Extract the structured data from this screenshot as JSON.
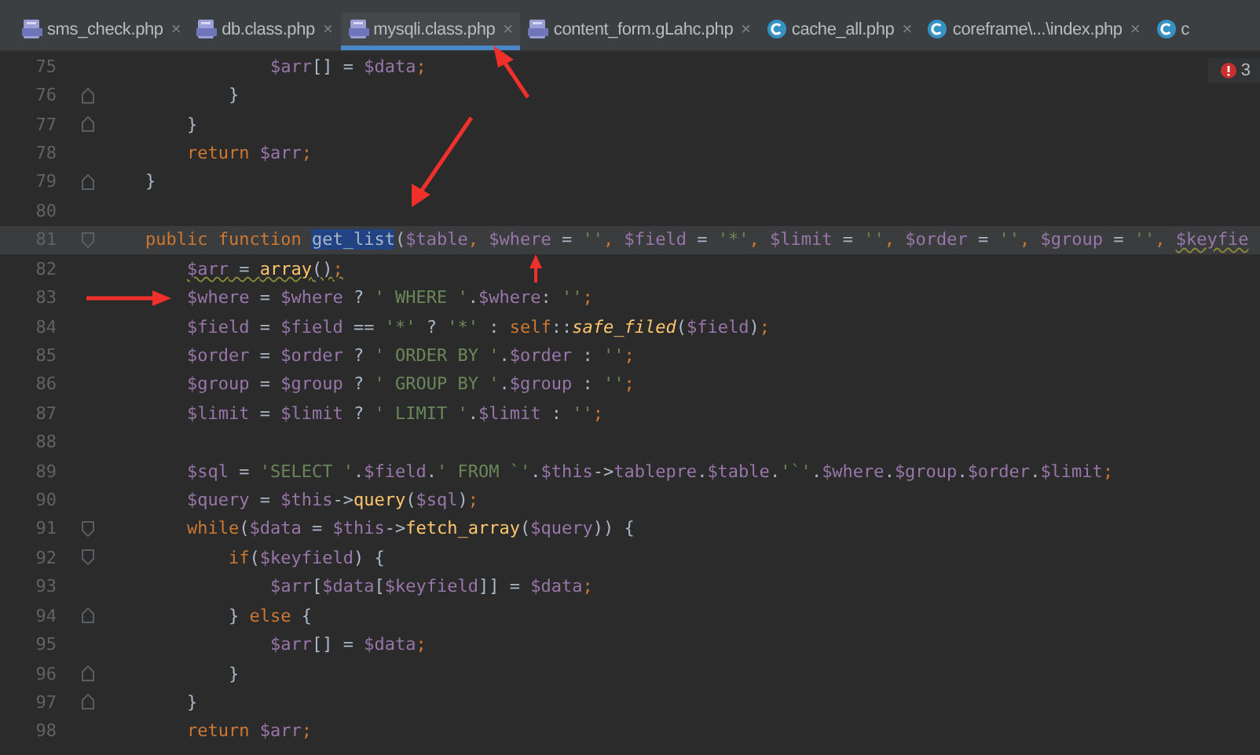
{
  "tabs": [
    {
      "label": "sms_check.php",
      "kind": "php",
      "close": "×",
      "selected": false
    },
    {
      "label": "db.class.php",
      "kind": "php",
      "close": "×",
      "selected": false
    },
    {
      "label": "mysqli.class.php",
      "kind": "php",
      "close": "×",
      "selected": true
    },
    {
      "label": "content_form.gLahc.php",
      "kind": "php",
      "close": "×",
      "selected": false
    },
    {
      "label": "cache_all.php",
      "kind": "class",
      "close": "×",
      "selected": false
    },
    {
      "label": "coreframe\\...\\index.php",
      "kind": "class",
      "close": "×",
      "selected": false
    },
    {
      "label": "c",
      "kind": "class",
      "selected": false
    }
  ],
  "problems": {
    "count": "3"
  },
  "lines": [
    {
      "number": "75",
      "kind": "plain",
      "current": false,
      "tokens": [
        {
          "kind": "var",
          "text": "                $arr"
        },
        {
          "kind": "plain",
          "text": "[] = "
        },
        {
          "kind": "var",
          "text": "$data"
        },
        {
          "kind": "punc",
          "text": ";"
        }
      ]
    },
    {
      "number": "76",
      "kind": "fold_end",
      "current": false,
      "tokens": [
        {
          "kind": "plain",
          "text": "            }"
        }
      ]
    },
    {
      "number": "77",
      "kind": "fold_end",
      "current": false,
      "tokens": [
        {
          "kind": "plain",
          "text": "        }"
        }
      ]
    },
    {
      "number": "78",
      "kind": "plain",
      "current": false,
      "tokens": [
        {
          "kind": "kw",
          "text": "        return "
        },
        {
          "kind": "var",
          "text": "$arr"
        },
        {
          "kind": "punc",
          "text": ";"
        }
      ]
    },
    {
      "number": "79",
      "kind": "fold_end",
      "current": false,
      "tokens": [
        {
          "kind": "plain",
          "text": "    }"
        }
      ]
    },
    {
      "number": "80",
      "kind": "plain",
      "current": false
    },
    {
      "number": "81",
      "kind": "fold_start",
      "current": true,
      "tokens": [
        {
          "kind": "kw",
          "text": "    public function "
        },
        {
          "kind": "fn_selected",
          "text": "get_list"
        },
        {
          "kind": "plain",
          "text": "("
        },
        {
          "kind": "var",
          "text": "$table"
        },
        {
          "kind": "punc",
          "text": ", "
        },
        {
          "kind": "var",
          "text": "$where"
        },
        {
          "kind": "plain",
          "text": " = "
        },
        {
          "kind": "str",
          "text": "''"
        },
        {
          "kind": "punc",
          "text": ", "
        },
        {
          "kind": "var",
          "text": "$field"
        },
        {
          "kind": "plain",
          "text": " = "
        },
        {
          "kind": "str",
          "text": "'*'"
        },
        {
          "kind": "punc",
          "text": ", "
        },
        {
          "kind": "var",
          "text": "$limit"
        },
        {
          "kind": "plain",
          "text": " = "
        },
        {
          "kind": "str",
          "text": "''"
        },
        {
          "kind": "punc",
          "text": ", "
        },
        {
          "kind": "var",
          "text": "$order"
        },
        {
          "kind": "plain",
          "text": " = "
        },
        {
          "kind": "str",
          "text": "''"
        },
        {
          "kind": "punc",
          "text": ", "
        },
        {
          "kind": "var",
          "text": "$group"
        },
        {
          "kind": "plain",
          "text": " = "
        },
        {
          "kind": "str",
          "text": "''"
        },
        {
          "kind": "punc",
          "text": ", "
        },
        {
          "kind": "var_warn",
          "text": "$keyfie"
        }
      ]
    },
    {
      "number": "82",
      "kind": "plain",
      "current": false,
      "tokens": [
        {
          "kind": "var_warn",
          "text": "        $arr"
        },
        {
          "kind": "plain_warn",
          "text": " = "
        },
        {
          "kind": "fn_warn",
          "text": "array"
        },
        {
          "kind": "plain_warn",
          "text": "()"
        },
        {
          "kind": "punc_warn",
          "text": ";"
        }
      ]
    },
    {
      "number": "83",
      "kind": "plain",
      "current": false,
      "tokens": [
        {
          "kind": "var",
          "text": "        $where"
        },
        {
          "kind": "plain",
          "text": " = "
        },
        {
          "kind": "var",
          "text": "$where"
        },
        {
          "kind": "plain",
          "text": " ? "
        },
        {
          "kind": "str",
          "text": "' WHERE '"
        },
        {
          "kind": "plain",
          "text": "."
        },
        {
          "kind": "var",
          "text": "$where"
        },
        {
          "kind": "plain",
          "text": ": "
        },
        {
          "kind": "str",
          "text": "''"
        },
        {
          "kind": "punc",
          "text": ";"
        }
      ]
    },
    {
      "number": "84",
      "kind": "plain",
      "current": false,
      "tokens": [
        {
          "kind": "var",
          "text": "        $field"
        },
        {
          "kind": "plain",
          "text": " = "
        },
        {
          "kind": "var",
          "text": "$field"
        },
        {
          "kind": "plain",
          "text": " == "
        },
        {
          "kind": "str",
          "text": "'*'"
        },
        {
          "kind": "plain",
          "text": " ? "
        },
        {
          "kind": "str",
          "text": "'*'"
        },
        {
          "kind": "plain",
          "text": " : "
        },
        {
          "kind": "kw",
          "text": "self"
        },
        {
          "kind": "plain",
          "text": "::"
        },
        {
          "kind": "fn_static",
          "text": "safe_filed"
        },
        {
          "kind": "plain",
          "text": "("
        },
        {
          "kind": "var",
          "text": "$field"
        },
        {
          "kind": "plain",
          "text": ")"
        },
        {
          "kind": "punc",
          "text": ";"
        }
      ]
    },
    {
      "number": "85",
      "kind": "plain",
      "current": false,
      "tokens": [
        {
          "kind": "var",
          "text": "        $order"
        },
        {
          "kind": "plain",
          "text": " = "
        },
        {
          "kind": "var",
          "text": "$order"
        },
        {
          "kind": "plain",
          "text": " ? "
        },
        {
          "kind": "str",
          "text": "' ORDER BY '"
        },
        {
          "kind": "plain",
          "text": "."
        },
        {
          "kind": "var",
          "text": "$order"
        },
        {
          "kind": "plain",
          "text": " : "
        },
        {
          "kind": "str",
          "text": "''"
        },
        {
          "kind": "punc",
          "text": ";"
        }
      ]
    },
    {
      "number": "86",
      "kind": "plain",
      "current": false,
      "tokens": [
        {
          "kind": "var",
          "text": "        $group"
        },
        {
          "kind": "plain",
          "text": " = "
        },
        {
          "kind": "var",
          "text": "$group"
        },
        {
          "kind": "plain",
          "text": " ? "
        },
        {
          "kind": "str",
          "text": "' GROUP BY '"
        },
        {
          "kind": "plain",
          "text": "."
        },
        {
          "kind": "var",
          "text": "$group"
        },
        {
          "kind": "plain",
          "text": " : "
        },
        {
          "kind": "str",
          "text": "''"
        },
        {
          "kind": "punc",
          "text": ";"
        }
      ]
    },
    {
      "number": "87",
      "kind": "plain",
      "current": false,
      "tokens": [
        {
          "kind": "var",
          "text": "        $limit"
        },
        {
          "kind": "plain",
          "text": " = "
        },
        {
          "kind": "var",
          "text": "$limit"
        },
        {
          "kind": "plain",
          "text": " ? "
        },
        {
          "kind": "str",
          "text": "' LIMIT '"
        },
        {
          "kind": "plain",
          "text": "."
        },
        {
          "kind": "var",
          "text": "$limit"
        },
        {
          "kind": "plain",
          "text": " : "
        },
        {
          "kind": "str",
          "text": "''"
        },
        {
          "kind": "punc",
          "text": ";"
        }
      ]
    },
    {
      "number": "88",
      "kind": "plain",
      "current": false
    },
    {
      "number": "89",
      "kind": "plain",
      "current": false,
      "tokens": [
        {
          "kind": "var",
          "text": "        $sql"
        },
        {
          "kind": "plain",
          "text": " = "
        },
        {
          "kind": "str",
          "text": "'SELECT '"
        },
        {
          "kind": "plain",
          "text": "."
        },
        {
          "kind": "var",
          "text": "$field"
        },
        {
          "kind": "plain",
          "text": "."
        },
        {
          "kind": "str",
          "text": "' FROM `'"
        },
        {
          "kind": "plain",
          "text": "."
        },
        {
          "kind": "var",
          "text": "$this"
        },
        {
          "kind": "plain",
          "text": "->"
        },
        {
          "kind": "var",
          "text": "tablepre"
        },
        {
          "kind": "plain",
          "text": "."
        },
        {
          "kind": "var",
          "text": "$table"
        },
        {
          "kind": "plain",
          "text": "."
        },
        {
          "kind": "str",
          "text": "'`'"
        },
        {
          "kind": "plain",
          "text": "."
        },
        {
          "kind": "var",
          "text": "$where"
        },
        {
          "kind": "plain",
          "text": "."
        },
        {
          "kind": "var",
          "text": "$group"
        },
        {
          "kind": "plain",
          "text": "."
        },
        {
          "kind": "var",
          "text": "$order"
        },
        {
          "kind": "plain",
          "text": "."
        },
        {
          "kind": "var",
          "text": "$limit"
        },
        {
          "kind": "punc",
          "text": ";"
        }
      ]
    },
    {
      "number": "90",
      "kind": "plain",
      "current": false,
      "tokens": [
        {
          "kind": "var",
          "text": "        $query"
        },
        {
          "kind": "plain",
          "text": " = "
        },
        {
          "kind": "var",
          "text": "$this"
        },
        {
          "kind": "plain",
          "text": "->"
        },
        {
          "kind": "fn",
          "text": "query"
        },
        {
          "kind": "plain",
          "text": "("
        },
        {
          "kind": "var",
          "text": "$sql"
        },
        {
          "kind": "plain",
          "text": ")"
        },
        {
          "kind": "punc",
          "text": ";"
        }
      ]
    },
    {
      "number": "91",
      "kind": "fold_start",
      "current": false,
      "tokens": [
        {
          "kind": "kw",
          "text": "        while"
        },
        {
          "kind": "plain",
          "text": "("
        },
        {
          "kind": "var",
          "text": "$data"
        },
        {
          "kind": "plain",
          "text": " = "
        },
        {
          "kind": "var",
          "text": "$this"
        },
        {
          "kind": "plain",
          "text": "->"
        },
        {
          "kind": "fn",
          "text": "fetch_array"
        },
        {
          "kind": "plain",
          "text": "("
        },
        {
          "kind": "var",
          "text": "$query"
        },
        {
          "kind": "plain",
          "text": ")) {"
        }
      ]
    },
    {
      "number": "92",
      "kind": "fold_start",
      "current": false,
      "tokens": [
        {
          "kind": "kw",
          "text": "            if"
        },
        {
          "kind": "plain",
          "text": "("
        },
        {
          "kind": "var",
          "text": "$keyfield"
        },
        {
          "kind": "plain",
          "text": ") {"
        }
      ]
    },
    {
      "number": "93",
      "kind": "plain",
      "current": false,
      "tokens": [
        {
          "kind": "var",
          "text": "                $arr"
        },
        {
          "kind": "plain",
          "text": "["
        },
        {
          "kind": "var",
          "text": "$data"
        },
        {
          "kind": "plain",
          "text": "["
        },
        {
          "kind": "var",
          "text": "$keyfield"
        },
        {
          "kind": "plain",
          "text": "]] = "
        },
        {
          "kind": "var",
          "text": "$data"
        },
        {
          "kind": "punc",
          "text": ";"
        }
      ]
    },
    {
      "number": "94",
      "kind": "fold_end",
      "current": false,
      "tokens": [
        {
          "kind": "plain",
          "text": "            } "
        },
        {
          "kind": "kw",
          "text": "else"
        },
        {
          "kind": "plain",
          "text": " {"
        }
      ]
    },
    {
      "number": "95",
      "kind": "plain",
      "current": false,
      "tokens": [
        {
          "kind": "var",
          "text": "                $arr"
        },
        {
          "kind": "plain",
          "text": "[] = "
        },
        {
          "kind": "var",
          "text": "$data"
        },
        {
          "kind": "punc",
          "text": ";"
        }
      ]
    },
    {
      "number": "96",
      "kind": "fold_end",
      "current": false,
      "tokens": [
        {
          "kind": "plain",
          "text": "            }"
        }
      ]
    },
    {
      "number": "97",
      "kind": "fold_end",
      "current": false,
      "tokens": [
        {
          "kind": "plain",
          "text": "        }"
        }
      ]
    },
    {
      "number": "98",
      "kind": "plain",
      "current": false,
      "tokens": [
        {
          "kind": "kw",
          "text": "        return "
        },
        {
          "kind": "var",
          "text": "$arr"
        },
        {
          "kind": "punc",
          "text": ";"
        }
      ]
    }
  ]
}
